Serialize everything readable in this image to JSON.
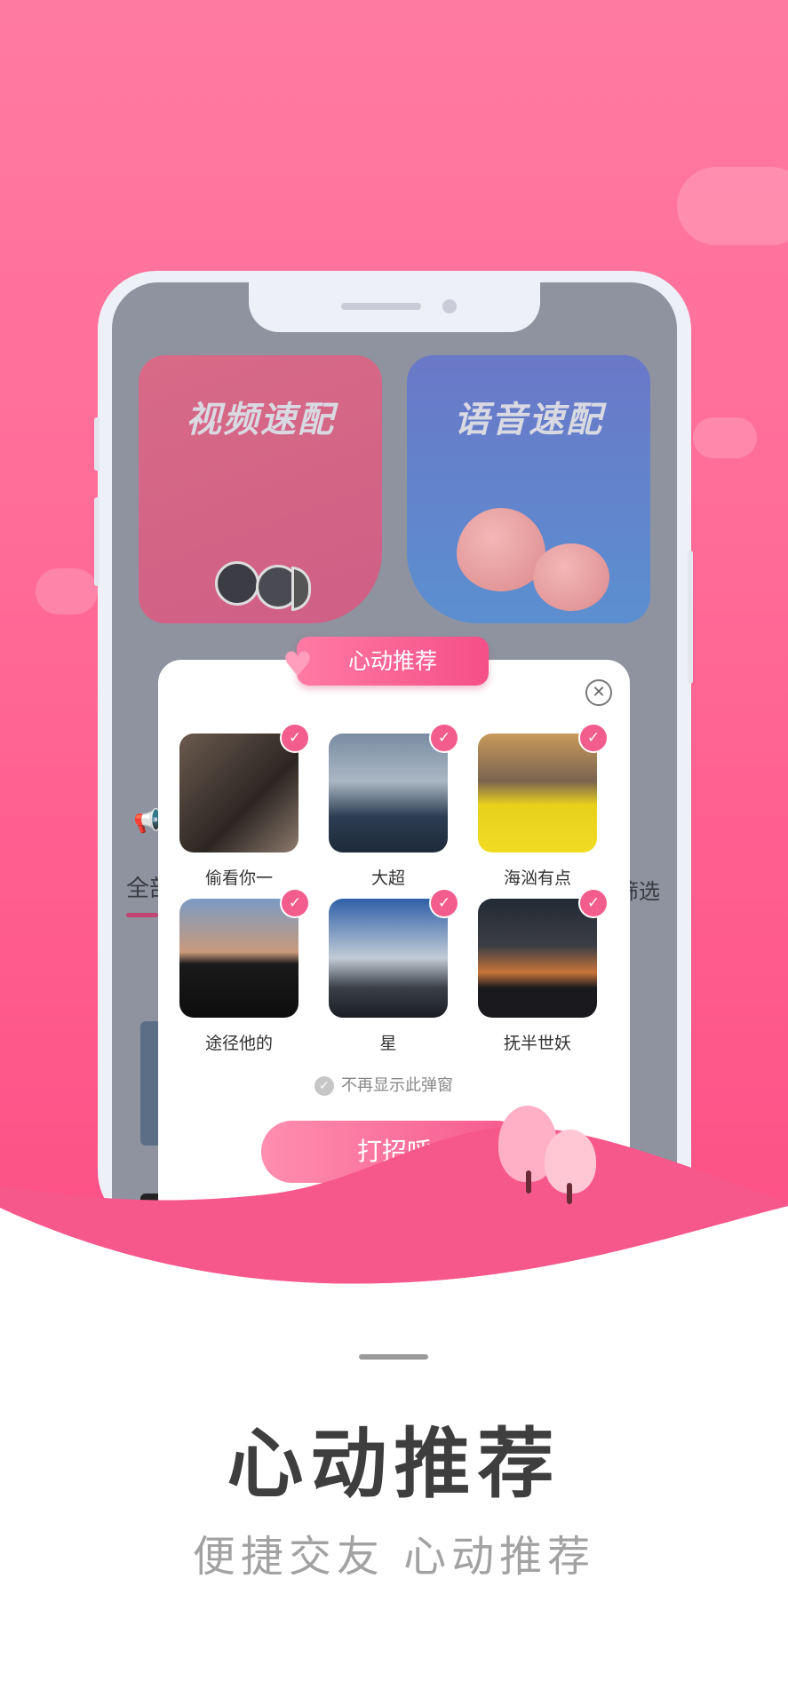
{
  "colors": {
    "accent": "#f25d8e",
    "background_top": "#ff6c98",
    "headline": "#3e3e3e",
    "subline": "#a2a2a2"
  },
  "app_screen": {
    "cards": [
      {
        "label": "视频速配"
      },
      {
        "label": "语音速配"
      }
    ],
    "tab_all": "全部",
    "filter": "筛选"
  },
  "modal": {
    "title": "心动推荐",
    "users": [
      {
        "name": "偷看你一",
        "checked": true
      },
      {
        "name": "大超",
        "checked": true
      },
      {
        "name": "海汹有点",
        "checked": true
      },
      {
        "name": "途径他的",
        "checked": true
      },
      {
        "name": "星",
        "checked": true
      },
      {
        "name": "抚半世妖",
        "checked": true
      }
    ],
    "dont_show_label": "不再显示此弹窗",
    "open_button_label": "打招呼"
  },
  "promo": {
    "headline": "心动推荐",
    "subline": "便捷交友 心动推荐"
  }
}
